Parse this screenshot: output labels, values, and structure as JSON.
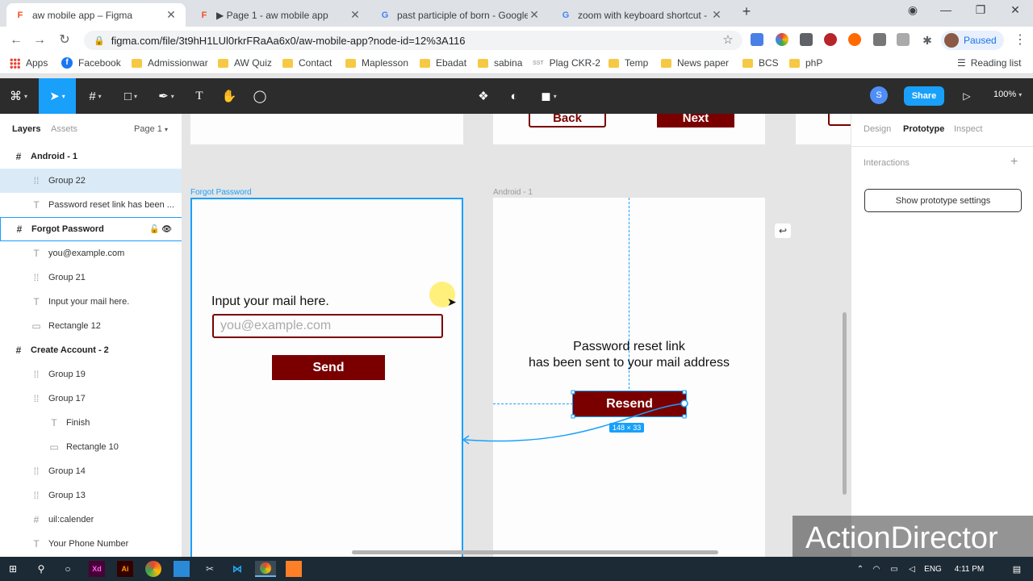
{
  "browser": {
    "tabs": [
      {
        "title": "aw mobile app – Figma",
        "active": true
      },
      {
        "title": "▶ Page 1 - aw mobile app",
        "active": false
      },
      {
        "title": "past participle of born - Google S",
        "active": false
      },
      {
        "title": "zoom with keyboard shortcut - G",
        "active": false
      }
    ],
    "url": "figma.com/file/3t9hH1LUl0rkrFRaAa6x0/aw-mobile-app?node-id=12%3A116",
    "profile_label": "Paused",
    "bookmarks": [
      "Apps",
      "Facebook",
      "Admissionwar",
      "AW Quiz",
      "Contact",
      "Maplesson",
      "Ebadat",
      "sabina",
      "Plag CKR-2",
      "Temp",
      "News paper",
      "BCS",
      "phP"
    ],
    "reading_list": "Reading list"
  },
  "figma": {
    "user_initial": "S",
    "share_label": "Share",
    "zoom_label": "100%",
    "left_tabs": {
      "layers": "Layers",
      "assets": "Assets",
      "page": "Page 1"
    },
    "layers": [
      {
        "name": "Android - 1",
        "icon": "#",
        "kind": "frame"
      },
      {
        "name": "Group 22",
        "icon": "⁞⁞",
        "kind": "child",
        "selected": true
      },
      {
        "name": "Password reset link has been ...",
        "icon": "T",
        "kind": "child"
      },
      {
        "name": "Forgot Password",
        "icon": "#",
        "kind": "frame",
        "outlined": true
      },
      {
        "name": "you@example.com",
        "icon": "T",
        "kind": "child"
      },
      {
        "name": "Group 21",
        "icon": "⁞⁞",
        "kind": "child"
      },
      {
        "name": "Input your mail here.",
        "icon": "T",
        "kind": "child"
      },
      {
        "name": "Rectangle 12",
        "icon": "▭",
        "kind": "child"
      },
      {
        "name": "Create Account - 2",
        "icon": "#",
        "kind": "frame"
      },
      {
        "name": "Group 19",
        "icon": "⁞⁞",
        "kind": "child"
      },
      {
        "name": "Group 17",
        "icon": "⁞⁞",
        "kind": "child"
      },
      {
        "name": "Finish",
        "icon": "T",
        "kind": "grandchild"
      },
      {
        "name": "Rectangle 10",
        "icon": "▭",
        "kind": "grandchild"
      },
      {
        "name": "Group 14",
        "icon": "⁞⁞",
        "kind": "child"
      },
      {
        "name": "Group 13",
        "icon": "⁞⁞",
        "kind": "child"
      },
      {
        "name": "uil:calender",
        "icon": "#",
        "kind": "child"
      },
      {
        "name": "Your Phone Number",
        "icon": "T",
        "kind": "child"
      }
    ],
    "right_tabs": {
      "design": "Design",
      "prototype": "Prototype",
      "inspect": "Inspect"
    },
    "interactions_label": "Interactions",
    "prototype_settings_label": "Show prototype settings",
    "canvas": {
      "top_back": "Back",
      "top_next": "Next",
      "forgot_frame_label": "Forgot Password",
      "android_frame_label": "Android - 1",
      "input_label": "Input your mail here.",
      "email_placeholder": "you@example.com",
      "send_label": "Send",
      "reset_line1": "Password reset link",
      "reset_line2": "has been sent to your mail address",
      "resend_label": "Resend",
      "size_badge": "148 × 33"
    }
  },
  "taskbar": {
    "lang": "ENG",
    "time": "4:11 PM"
  },
  "overlay": {
    "watermark": "ActionDirector"
  },
  "colors": {
    "figma_blue": "#18a0fb",
    "maroon": "#7a0000",
    "toolbar": "#2c2c2c"
  }
}
